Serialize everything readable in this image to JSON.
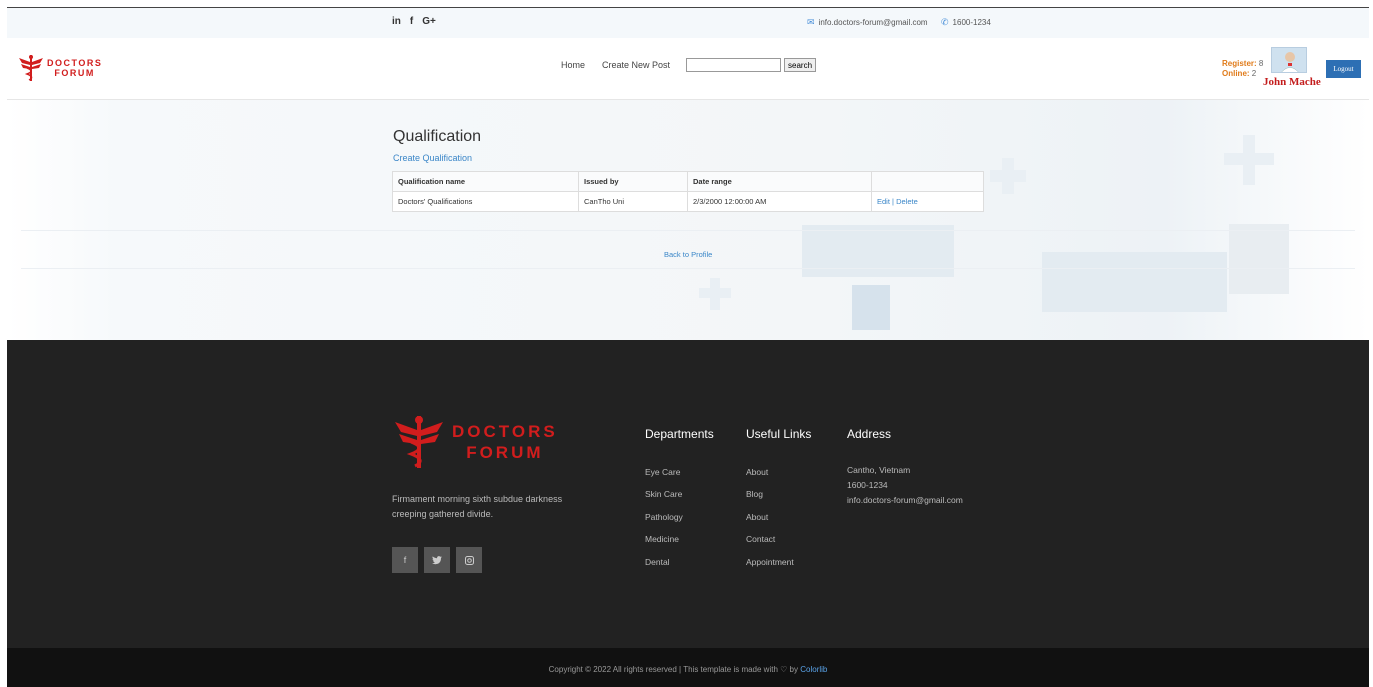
{
  "topbar": {
    "social": [
      "in",
      "f",
      "G+"
    ],
    "email": "info.doctors-forum@gmail.com",
    "phone": "1600-1234"
  },
  "header": {
    "logo_line1": "DOCTORS",
    "logo_line2": "FORUM",
    "nav": [
      "Home",
      "Create New Post"
    ],
    "search_button": "search",
    "register_label": "Register:",
    "register_count": "8",
    "online_label": "Online:",
    "online_count": "2",
    "username": "John Mache",
    "logout_label": "Logout"
  },
  "main": {
    "title": "Qualification",
    "create_link": "Create Qualification",
    "table": {
      "headers": [
        "Qualification name",
        "Issued by",
        "Date range",
        ""
      ],
      "rows": [
        {
          "name": "Doctors' Qualifications",
          "issued_by": "CanTho Uni",
          "date_range": "2/3/2000 12:00:00 AM",
          "edit": "Edit",
          "sep": " | ",
          "delete": "Delete"
        }
      ]
    },
    "back_link": "Back to Profile"
  },
  "footer": {
    "logo_line1": "DOCTORS",
    "logo_line2": "FORUM",
    "description": "Firmament morning sixth subdue darkness creeping gathered divide.",
    "social": [
      "f",
      "t",
      "o"
    ],
    "departments": {
      "title": "Departments",
      "items": [
        "Eye Care",
        "Skin Care",
        "Pathology",
        "Medicine",
        "Dental"
      ]
    },
    "useful_links": {
      "title": "Useful Links",
      "items": [
        "About",
        "Blog",
        "About",
        "Contact",
        "Appointment"
      ]
    },
    "address": {
      "title": "Address",
      "lines": [
        "Cantho, Vietnam",
        "1600-1234",
        "info.doctors-forum@gmail.com"
      ]
    },
    "copyright": "Copyright © 2022 All rights reserved | This template is made with",
    "copyright_by": "by",
    "copyright_brand": "Colorlib"
  },
  "colors": {
    "brand_red": "#d11d1d",
    "link_blue": "#3a86c8",
    "logout_blue": "#2d6fb4",
    "footer_bg": "#222222"
  }
}
